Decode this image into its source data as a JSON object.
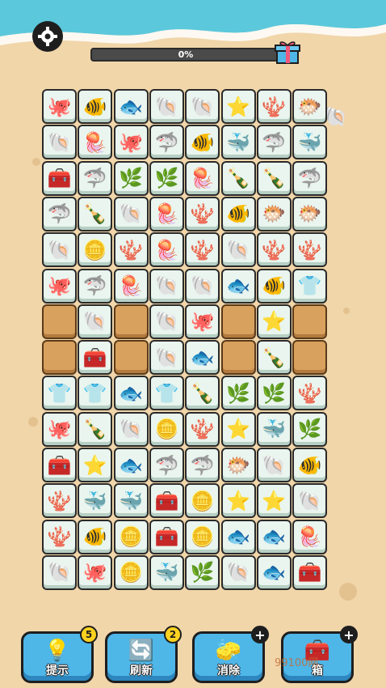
{
  "hud": {
    "progress_text": "0%",
    "progress_fraction": 0.0
  },
  "board": {
    "rows": [
      [
        "octopus",
        "clownfish",
        "angelfish",
        "shell-purple",
        "shell-purple",
        "starfish",
        "coral-blue",
        "pufferfish"
      ],
      [
        "conch",
        "jellyfish",
        "octopus",
        "stingray",
        "clownfish",
        "whale",
        "stingray",
        "whale"
      ],
      [
        "chest",
        "shark",
        "seaweed",
        "seaweed",
        "jellyfish",
        "bottle",
        "bottle",
        "stingray"
      ],
      [
        "stingray",
        "bottle",
        "conch",
        "jellyfish",
        "coral-orange",
        "clownfish",
        "pufferfish",
        "pufferfish"
      ],
      [
        "conch",
        "coins",
        "coral-orange",
        "jellyfish",
        "coral-orange",
        "scallop",
        "coral-blue",
        "coral-blue"
      ],
      [
        "octopus",
        "shark",
        "jellyfish",
        "scallop",
        "shell-purple",
        "fish-yellow",
        "clownfish",
        "wetsuit"
      ],
      [
        "wood",
        "scallop",
        "wood",
        "conch",
        "octopus",
        "wood",
        "starfish",
        "wood"
      ],
      [
        "wood",
        "chest",
        "wood",
        "conch",
        "angelfish",
        "wood",
        "bottle",
        "wood"
      ],
      [
        "wetsuit",
        "wetsuit",
        "fish-yellow",
        "wetsuit",
        "bottle",
        "seaweed",
        "seaweed",
        "coral-blue"
      ],
      [
        "octopus",
        "bottle",
        "scallop",
        "coins",
        "coral-orange",
        "starfish",
        "whale",
        "seaweed"
      ],
      [
        "chest",
        "starfish",
        "angelfish",
        "shark",
        "shark",
        "pufferfish",
        "conch",
        "clownfish"
      ],
      [
        "coral-blue",
        "whale",
        "whale",
        "chest",
        "coins",
        "starfish",
        "starfish",
        "shell-purple"
      ],
      [
        "coral-blue",
        "clownfish",
        "coins",
        "chest",
        "coins",
        "fish-yellow",
        "fish-yellow",
        "jellyfish"
      ],
      [
        "shell-purple",
        "octopus",
        "coins",
        "whale",
        "seaweed",
        "shell-purple",
        "angelfish",
        "chest"
      ]
    ],
    "glyphs": {
      "octopus": "🐙",
      "clownfish": "🐠",
      "angelfish": "🐟",
      "shell-purple": "🐚",
      "starfish": "⭐",
      "coral-blue": "🪸",
      "pufferfish": "🐡",
      "conch": "🐚",
      "jellyfish": "🪼",
      "stingray": "🦈",
      "whale": "🐳",
      "chest": "🧰",
      "shark": "🦈",
      "seaweed": "🌿",
      "bottle": "🍾",
      "coral-orange": "🪸",
      "coins": "🪙",
      "scallop": "🐚",
      "fish-yellow": "🐟",
      "wetsuit": "👕",
      "wood": ""
    },
    "tile_colors": {
      "octopus": "#f07aa0",
      "clownfish": "#f47a2a",
      "angelfish": "#4fc9e6",
      "shell-purple": "#7a4fd0",
      "starfish": "#f06a2a",
      "coral-blue": "#3b7fc4",
      "pufferfish": "#9ccf3a",
      "conch": "#f2964a",
      "jellyfish": "#f6b27a",
      "stingray": "#3566c4",
      "whale": "#3ba4e6",
      "chest": "#d98b3a",
      "shark": "#4a4ac4",
      "seaweed": "#3cb84a",
      "bottle": "#b8dce6",
      "coral-orange": "#f2a24a",
      "coins": "#f2c22a",
      "scallop": "#f07aa0",
      "fish-yellow": "#d6d62a",
      "wetsuit": "#c04ac0",
      "wood": "#d9a15e"
    }
  },
  "powerups": [
    {
      "label": "提示",
      "icon": "💡",
      "badge": "5",
      "badge_type": "num"
    },
    {
      "label": "刷新",
      "icon": "🔄",
      "badge": "2",
      "badge_type": "num"
    },
    {
      "label": "消除",
      "icon": "🧽",
      "badge": "+",
      "badge_type": "plus"
    },
    {
      "label": "箱",
      "icon": "🧰",
      "badge": "+",
      "badge_type": "plus"
    }
  ],
  "watermark": "99100网"
}
